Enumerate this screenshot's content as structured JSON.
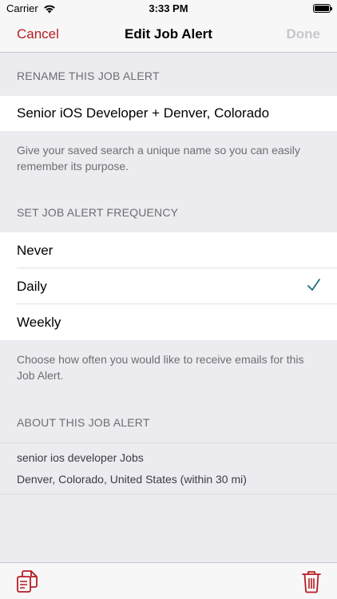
{
  "status_bar": {
    "carrier": "Carrier",
    "time": "3:33 PM"
  },
  "nav": {
    "cancel_label": "Cancel",
    "title": "Edit Job Alert",
    "done_label": "Done"
  },
  "rename_section": {
    "header": "RENAME THIS JOB ALERT",
    "name_value": "Senior iOS Developer + Denver, Colorado",
    "footer": "Give your saved search a unique name so you can easily remember its purpose."
  },
  "frequency_section": {
    "header": "SET JOB ALERT FREQUENCY",
    "options": [
      {
        "label": "Never",
        "selected": false
      },
      {
        "label": "Daily",
        "selected": true
      },
      {
        "label": "Weekly",
        "selected": false
      }
    ],
    "footer": "Choose how often you would like to receive emails for this Job Alert."
  },
  "about_section": {
    "header": "ABOUT THIS JOB ALERT",
    "lines": [
      "senior ios developer Jobs",
      "Denver, Colorado, United States (within 30 mi)"
    ]
  },
  "toolbar": {
    "left_icon": "copy-icon",
    "right_icon": "trash-icon"
  },
  "colors": {
    "accent": "#b81c24",
    "checkmark": "#1f6f7e",
    "done_disabled": "#c7c7cc",
    "section_text": "#6d6d72",
    "background": "#ebebf0"
  }
}
